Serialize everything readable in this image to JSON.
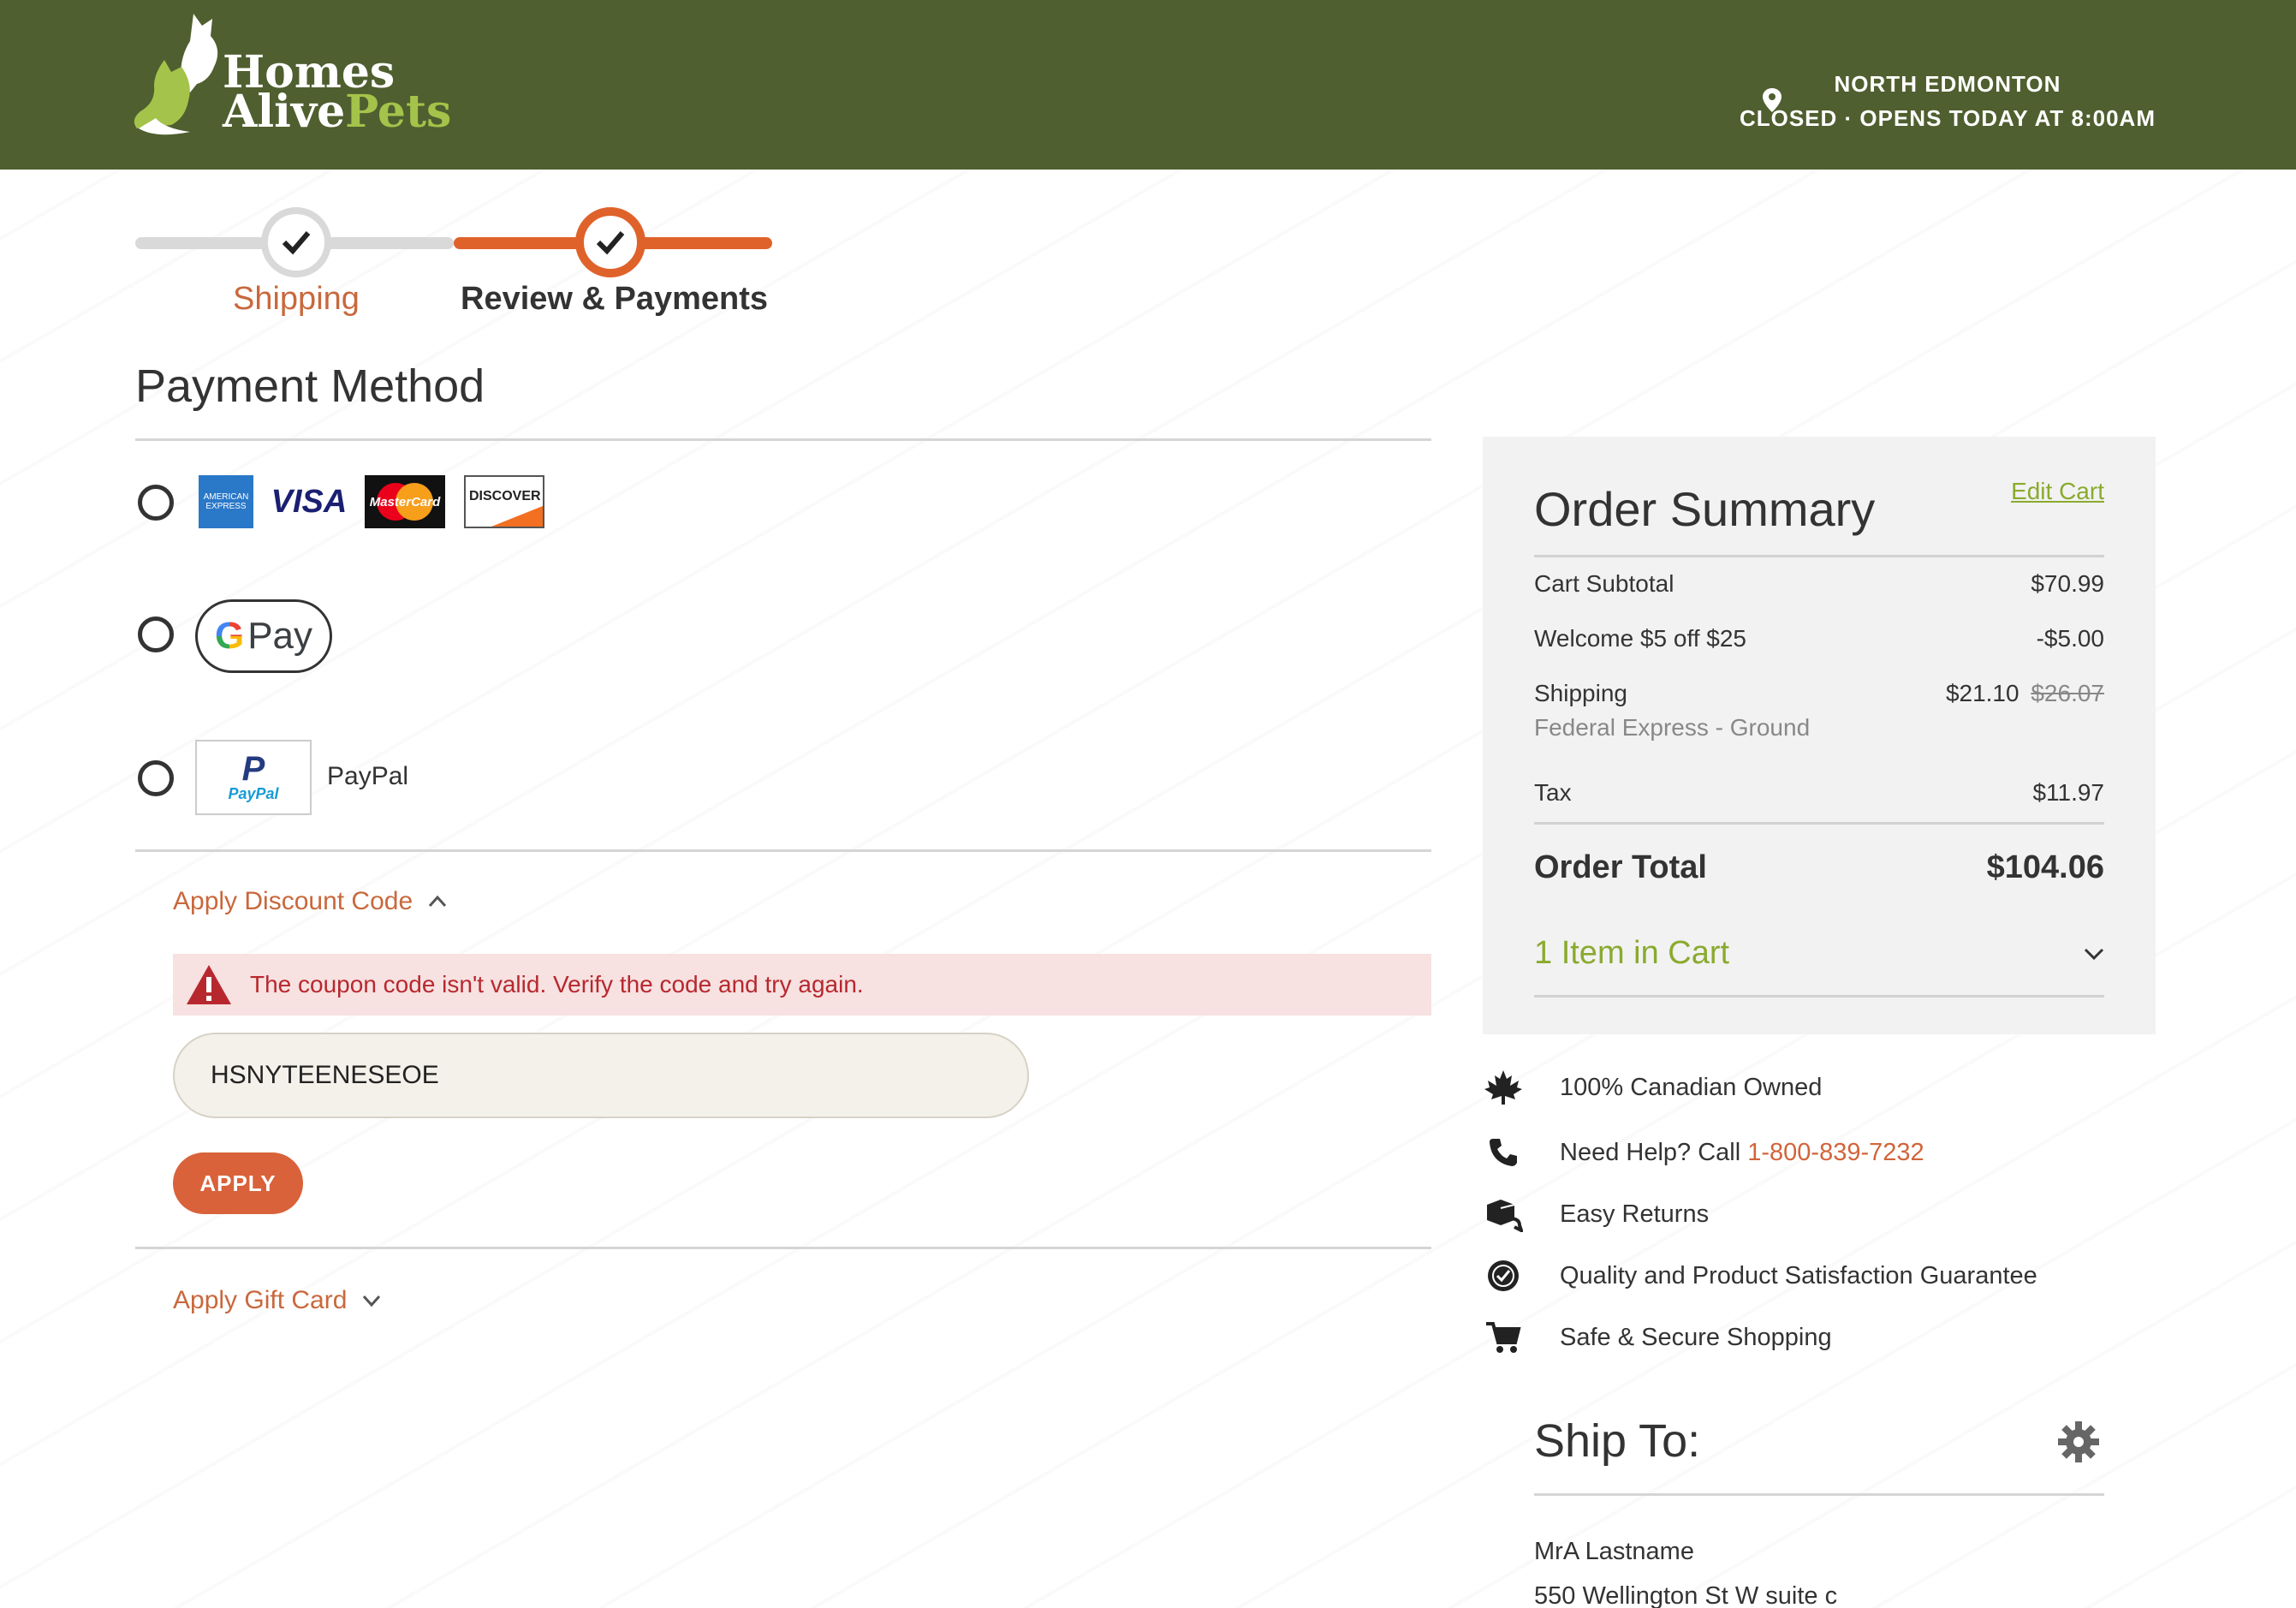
{
  "header": {
    "logo_line1": "Homes",
    "logo_line2_a": "Alive",
    "logo_line2_b": "Pets",
    "store_name": "NORTH EDMONTON",
    "store_status": "CLOSED · OPENS TODAY AT 8:00AM",
    "colors": {
      "bar": "#4f5f2f",
      "logo_accent": "#a4c34a"
    }
  },
  "stepper": {
    "steps": [
      {
        "label": "Shipping",
        "state": "complete"
      },
      {
        "label": "Review & Payments",
        "state": "active"
      }
    ],
    "accent": "#e0622b"
  },
  "payment": {
    "title": "Payment Method",
    "card_logos": [
      "amex",
      "visa",
      "mastercard",
      "discover"
    ],
    "visa_text": "VISA",
    "mastercard_text": "MasterCard",
    "discover_text": "DISCOVER",
    "gpay_text": "Pay",
    "paypal_label": "PayPal",
    "paypal_logo_text": "PayPal"
  },
  "discount": {
    "toggle_label": "Apply Discount Code",
    "error": "The coupon code isn't valid. Verify the code and try again.",
    "code_value": "HSNYTEENESEOE",
    "apply_label": "APPLY"
  },
  "gift_card": {
    "toggle_label": "Apply Gift Card"
  },
  "summary": {
    "title": "Order Summary",
    "edit_cart": "Edit Cart",
    "rows": {
      "subtotal_label": "Cart Subtotal",
      "subtotal_value": "$70.99",
      "discount_label": "Welcome $5 off $25",
      "discount_value": "-$5.00",
      "shipping_label": "Shipping",
      "shipping_method": "Federal Express - Ground",
      "shipping_value": "$21.10",
      "shipping_original": "$26.07",
      "tax_label": "Tax",
      "tax_value": "$11.97",
      "total_label": "Order Total",
      "total_value": "$104.06"
    },
    "items_in_cart": "1 Item in Cart"
  },
  "features": {
    "canadian": "100% Canadian Owned",
    "help_prefix": "Need Help? Call",
    "help_phone": "1-800-839-7232",
    "returns": "Easy Returns",
    "guarantee": "Quality and Product Satisfaction Guarantee",
    "secure": "Safe & Secure Shopping"
  },
  "ship_to": {
    "title": "Ship To:",
    "name": "MrA Lastname",
    "address": "550 Wellington St W suite c"
  }
}
